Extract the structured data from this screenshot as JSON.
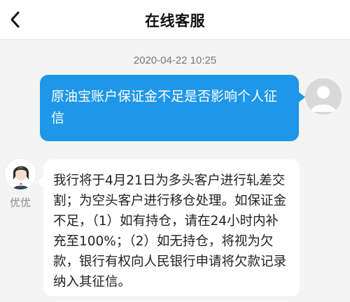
{
  "header": {
    "title": "在线客服",
    "back_icon": "chevron-left-icon"
  },
  "chat": {
    "timestamp": "2020-04-22 10:25",
    "messages": [
      {
        "role": "user",
        "avatar_icon": "user-avatar-icon",
        "text": "原油宝账户保证金不足是否影响个人征信"
      },
      {
        "role": "agent",
        "name": "优优",
        "avatar_icon": "agent-avatar-icon",
        "text": "我行将于4月21日为多头客户进行轧差交割；为空头客户进行移仓处理。如保证金不足，（1）如有持仓，请在24小时内补充至100%；（2）如无持仓，将视为欠款，银行有权向人民银行申请将欠款记录纳入其征信。"
      }
    ]
  },
  "colors": {
    "user_bubble": "#1f97e8",
    "agent_bubble": "#ffffff",
    "background": "#f4f4f4"
  }
}
